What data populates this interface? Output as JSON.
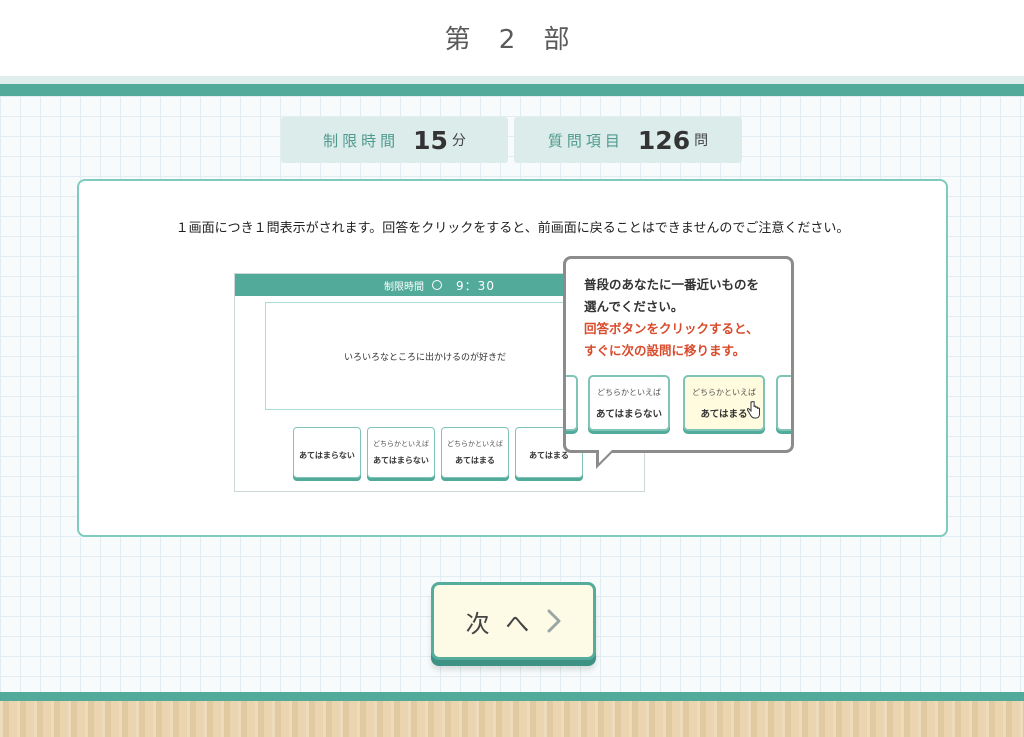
{
  "header": {
    "title": "第 2 部"
  },
  "info": {
    "time_label": "制限時間",
    "time_value": "15",
    "time_unit": "分",
    "items_label": "質問項目",
    "items_value": "126",
    "items_unit": "問"
  },
  "instruction": "１画面につき１問表示がされます。回答をクリックをすると、前画面に戻ることはできませんのでご注意ください。",
  "demo": {
    "bar_label": "制限時間",
    "bar_time": "9：30",
    "question": "いろいろなところに出かけるのが好きだ",
    "answers": [
      {
        "top": "",
        "main": "あてはまらない"
      },
      {
        "top": "どちらかといえば",
        "main": "あてはまらない"
      },
      {
        "top": "どちらかといえば",
        "main": "あてはまる"
      },
      {
        "top": "",
        "main": "あてはまる"
      }
    ]
  },
  "bubble": {
    "line1": "普段のあなたに一番近いものを",
    "line2": "選んでください。",
    "line3": "回答ボタンをクリックすると、",
    "line4": "すぐに次の設問に移ります。",
    "btn1_top": "どちらかといえば",
    "btn1_main": "あてはまらない",
    "btn2_top": "どちらかといえば",
    "btn2_main": "あてはまる"
  },
  "next_button": {
    "label": "次 へ",
    "icon": "chevron-right-icon"
  },
  "colors": {
    "teal": "#52aa9b",
    "accent_red": "#d84b2c",
    "button_bg": "#fdfbe6"
  }
}
